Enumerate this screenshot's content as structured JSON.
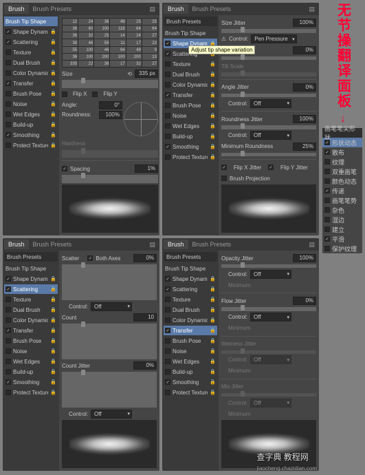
{
  "tabs": {
    "brush": "Brush",
    "presets": "Brush Presets"
  },
  "sidebar_header": "Brush Tip Shape",
  "options": {
    "shape_dynamics": "Shape Dynamics",
    "scattering": "Scattering",
    "texture": "Texture",
    "dual_brush": "Dual Brush",
    "color_dynamics": "Color Dynamics",
    "transfer": "Transfer",
    "brush_pose": "Brush Pose",
    "noise": "Noise",
    "wet_edges": "Wet Edges",
    "build_up": "Build-up",
    "smoothing": "Smoothing",
    "protect_texture": "Protect Texture"
  },
  "panel1": {
    "thumbs": [
      "12",
      "24",
      "36",
      "48",
      "25",
      "25",
      "36",
      "60",
      "100",
      "118",
      "64",
      "64",
      "36",
      "32",
      "25",
      "14",
      "24",
      "27",
      "39",
      "46",
      "59",
      "11",
      "17",
      "23",
      "55",
      "100",
      "46",
      "94",
      "48",
      "9",
      "36",
      "100",
      "200",
      "100",
      "200",
      "13",
      "335",
      "22",
      "36",
      "17",
      "32",
      "27"
    ],
    "size_label": "Size",
    "size_val": "335 px",
    "flip_x": "Flip X",
    "flip_y": "Flip Y",
    "angle_label": "Angle:",
    "angle_val": "0°",
    "roundness_label": "Roundness:",
    "roundness_val": "100%",
    "hardness_label": "Hardness",
    "spacing_label": "Spacing",
    "spacing_val": "1%"
  },
  "panel2": {
    "header1": "Brush Presets",
    "size_jitter": "Size Jitter",
    "size_jitter_val": "100%",
    "control_label": "Control:",
    "control_pen": "Pen Pressure",
    "min_diameter": "Minimum Diameter",
    "min_diameter_val": "0%",
    "tilt_scale": "Tilt Scale",
    "angle_jitter": "Angle Jitter",
    "angle_jitter_val": "0%",
    "control_off": "Off",
    "roundness_jitter": "Roundness Jitter",
    "roundness_jitter_val": "100%",
    "min_roundness": "Minimum Roundness",
    "min_roundness_val": "25%",
    "flip_x_jitter": "Flip X Jitter",
    "flip_y_jitter": "Flip Y Jitter",
    "brush_projection": "Brush Projection",
    "tooltip": "Adjust tip shape variation",
    "warn": "⚠",
    "diameter_label": "Diameter"
  },
  "panel3": {
    "header1": "Brush Presets",
    "scatter": "Scatter",
    "both_axes": "Both Axes",
    "scatter_val": "0%",
    "control_off": "Off",
    "count": "Count",
    "count_val": "10",
    "count_jitter": "Count Jitter",
    "count_jitter_val": "0%"
  },
  "panel4": {
    "header1": "Brush Presets",
    "opacity_jitter": "Opacity Jitter",
    "opacity_val": "100%",
    "control_off": "Off",
    "minimum": "Minimum",
    "flow_jitter": "Flow Jitter",
    "flow_val": "0%",
    "wetness_jitter": "Wetness Jitter",
    "mix_jitter": "Mix Jitter"
  },
  "zh": {
    "big": "无节操翻译面板",
    "header": "画笔笔尖形状",
    "items": [
      "形状动态",
      "散布",
      "纹理",
      "双重画笔",
      "颜色动态",
      "传递",
      "画笔笔势",
      "杂色",
      "湿边",
      "建立",
      "平滑",
      "保护纹理"
    ]
  },
  "watermark": {
    "main": "查字典 教程网",
    "sub": "jiaocheng.chazidian.com"
  },
  "checks": [
    "✓"
  ]
}
